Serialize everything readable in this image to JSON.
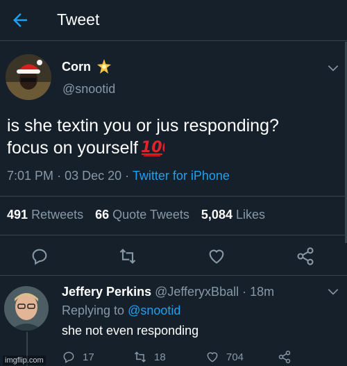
{
  "header": {
    "title": "Tweet",
    "back_icon": "arrow-left-icon"
  },
  "tweet": {
    "author_name": "Corn",
    "author_handle": "@snootid",
    "badge_icon": "sparkle-icon",
    "text_line1": "is she textin you or jus responding?",
    "text_line2": "focus on yourself",
    "emoji_icon": "hundred-points-icon",
    "time": "7:01 PM",
    "date": "03 Dec 20",
    "source": "Twitter for iPhone",
    "retweets": "491",
    "retweets_label": "Retweets",
    "quote_tweets": "66",
    "quote_tweets_label": "Quote Tweets",
    "likes": "5,084",
    "likes_label": "Likes"
  },
  "reply": {
    "author_name": "Jeffery Perkins",
    "author_handle": "@JefferyxBball",
    "age": "18m",
    "replying_to_label": "Replying to",
    "replying_to_handle": "@snootid",
    "text": "she not even responding",
    "reply_count": "17",
    "retweet_count": "18",
    "like_count": "704"
  },
  "watermark": "imgflip.com",
  "colors": {
    "background": "#15202b",
    "accent": "#1da1f2",
    "muted": "#8899a6",
    "divider": "#38444d"
  }
}
